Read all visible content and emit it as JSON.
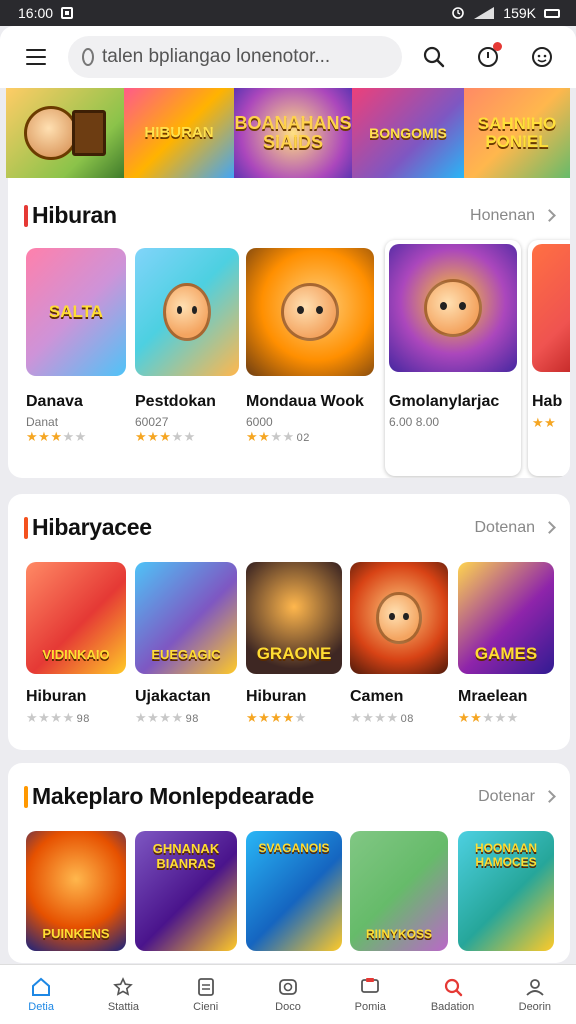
{
  "status_bar": {
    "time": "16:00",
    "right_text": "159K"
  },
  "search": {
    "placeholder": "talen bpliangao lonenotor..."
  },
  "banner": [
    {
      "text": ""
    },
    {
      "text": "HIBURAN"
    },
    {
      "text": "BOANAHANS SIAIDS"
    },
    {
      "text": "BONGOMIS"
    },
    {
      "text": "SAHNIHO PONIEL"
    }
  ],
  "sections": [
    {
      "title": "Hiburan",
      "more": "Honenan",
      "accent": "#e53935",
      "items": [
        {
          "name": "Danava",
          "sub": "Danat",
          "rating": 2.5,
          "rating_text": "",
          "thumb_text": "SALTA"
        },
        {
          "name": "Pestdokan",
          "sub": "60027",
          "rating": 3,
          "rating_text": "",
          "thumb_text": ""
        },
        {
          "name": "Mondaua Wook",
          "sub": "6000",
          "rating": 2,
          "rating_text": "02",
          "thumb_text": ""
        },
        {
          "name": "Gmolanylarjac",
          "sub": "6.00 8.00",
          "rating": 0,
          "rating_text": "",
          "thumb_text": ""
        },
        {
          "name": "Hab",
          "sub": "",
          "rating": 2,
          "rating_text": "",
          "thumb_text": ""
        }
      ]
    },
    {
      "title": "Hibaryacee",
      "more": "Dotenan",
      "accent": "#f4511e",
      "items": [
        {
          "name": "Hiburan",
          "sub": "",
          "rating": 0,
          "rating_text": "98",
          "thumb_text": "VIDINKAIO"
        },
        {
          "name": "Ujakactan",
          "sub": "",
          "rating": 0,
          "rating_text": "98",
          "thumb_text": "EUEGAGIC"
        },
        {
          "name": "Hiburan",
          "sub": "",
          "rating": 3.5,
          "rating_text": "",
          "thumb_text": "GRAONE"
        },
        {
          "name": "Camen",
          "sub": "",
          "rating": 0,
          "rating_text": "08",
          "thumb_text": ""
        },
        {
          "name": "Mraelean",
          "sub": "",
          "rating": 2,
          "rating_text": "",
          "thumb_text": "GAMES"
        }
      ]
    },
    {
      "title": "Makeplaro Monlepdearade",
      "more": "Dotenar",
      "accent": "#ff9800",
      "items": [
        {
          "thumb_text": "PUINKENS"
        },
        {
          "thumb_text": "GHNANAK BIANRAS"
        },
        {
          "thumb_text": "SVAGANOIS"
        },
        {
          "thumb_text": "RIINYKOSS"
        },
        {
          "thumb_text": "HOONAAN HAMOCES"
        }
      ]
    }
  ],
  "bottom_nav": [
    {
      "label": "Detia",
      "icon": "home-icon",
      "active": true
    },
    {
      "label": "Stattia",
      "icon": "star-icon",
      "active": false
    },
    {
      "label": "Cieni",
      "icon": "document-icon",
      "active": false
    },
    {
      "label": "Doco",
      "icon": "camera-icon",
      "active": false
    },
    {
      "label": "Pomia",
      "icon": "message-icon",
      "active": false
    },
    {
      "label": "Badation",
      "icon": "search-icon",
      "active": false
    },
    {
      "label": "Deorin",
      "icon": "profile-icon",
      "active": false
    }
  ],
  "colors": {
    "accent_blue": "#1e88e5",
    "star": "#f5a623",
    "badge_red": "#e53935"
  }
}
